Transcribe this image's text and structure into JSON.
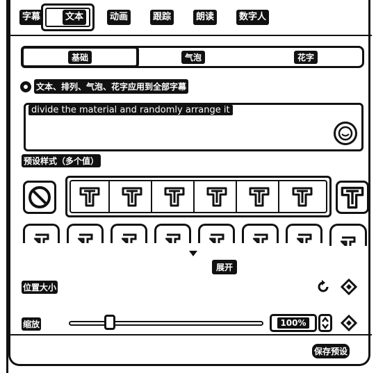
{
  "tabs": [
    "字幕",
    "文本",
    "动画",
    "跟踪",
    "朗读",
    "数字人"
  ],
  "active_tab": "文本",
  "segments": [
    "基础",
    "气泡",
    "花字"
  ],
  "active_segment": "基础",
  "apply_all_label": "文本、排列、气泡、花字应用到全部字幕",
  "text_input": {
    "value": "divide the material and randomly arrange it"
  },
  "preset_styles_label": "预设样式（多个值）",
  "expand_label": "展开",
  "position_size_label": "位置大小",
  "scale": {
    "label": "缩放",
    "value": "100%",
    "level": 0.21
  },
  "save_preset_label": "保存预设",
  "icons": [
    "no-style-icon",
    "emoji-icon",
    "chevron-down-icon",
    "reset-icon",
    "keyframe-diamond-icon",
    "stepper-arrows-icon"
  ],
  "colors": {
    "ink": "#111111",
    "paper": "#ffffff"
  }
}
